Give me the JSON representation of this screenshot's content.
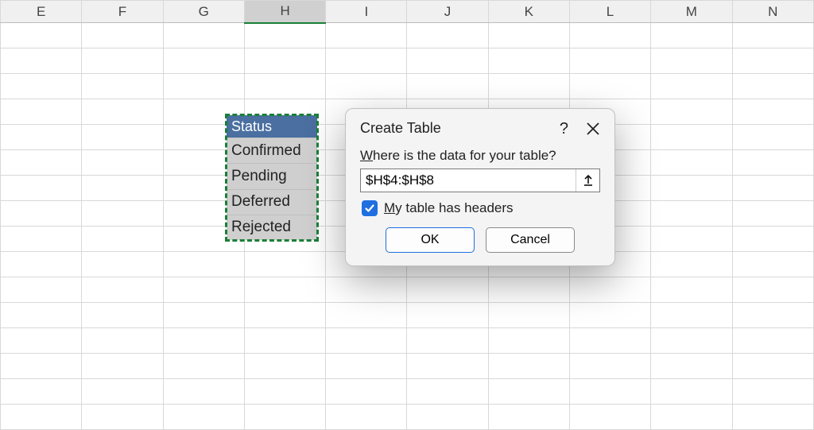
{
  "columns": [
    "E",
    "F",
    "G",
    "H",
    "I",
    "J",
    "K",
    "L",
    "M",
    "N"
  ],
  "active_column": "H",
  "selection": {
    "header": "Status",
    "rows": [
      "Confirmed",
      "Pending",
      "Deferred",
      "Rejected"
    ]
  },
  "dialog": {
    "title": "Create Table",
    "prompt_pre": "W",
    "prompt_rest": "here is the data for your table?",
    "range_value": "$H$4:$H$8",
    "checkbox_pre": "M",
    "checkbox_rest": "y table has headers",
    "checkbox_checked": true,
    "ok": "OK",
    "cancel": "Cancel"
  }
}
